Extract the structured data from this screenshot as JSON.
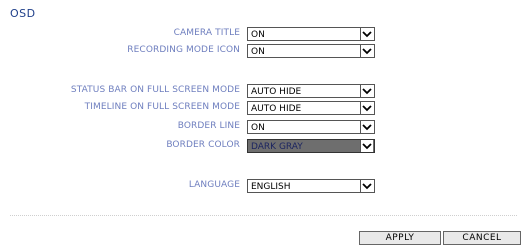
{
  "page": {
    "title": "OSD"
  },
  "settings": [
    {
      "label": "CAMERA TITLE",
      "value": "ON"
    },
    {
      "label": "RECORDING MODE ICON",
      "value": "ON"
    },
    {
      "label": "STATUS BAR ON FULL SCREEN MODE",
      "value": "AUTO HIDE"
    },
    {
      "label": "TIMELINE ON FULL SCREEN MODE",
      "value": "AUTO HIDE"
    },
    {
      "label": "BORDER LINE",
      "value": "ON"
    },
    {
      "label": "BORDER COLOR",
      "value": "DARK GRAY"
    },
    {
      "label": "LANGUAGE",
      "value": "ENGLISH"
    }
  ],
  "buttons": {
    "apply": "APPLY",
    "cancel": "CANCEL"
  },
  "icons": {
    "dropdown": "chevron-down-icon"
  },
  "colors": {
    "title": "#1f3f8a",
    "label": "#6f7fbf",
    "border_color_swatch": "#6e6e6e"
  }
}
